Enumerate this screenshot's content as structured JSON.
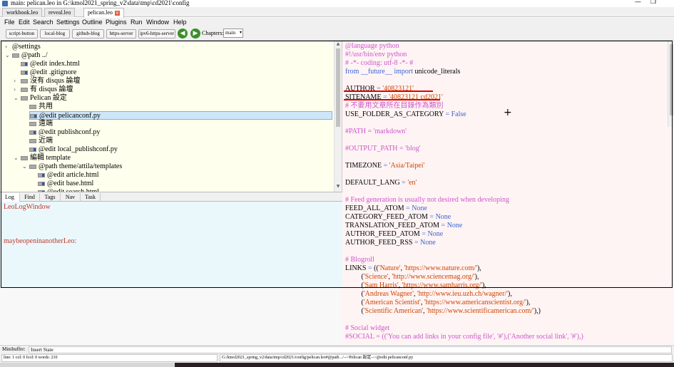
{
  "window": {
    "title": "main: pelican.leo in G:\\kmol2021_spring_v2\\data\\tmp\\cd2021\\config",
    "minimize": "—",
    "maximize": "❐"
  },
  "tabs": [
    {
      "label": "workbook.leo",
      "active": false
    },
    {
      "label": "reveal.leo",
      "active": false
    },
    {
      "label": "pelican.leo",
      "active": true
    }
  ],
  "tab_close": "×",
  "menu": [
    "File",
    "Edit",
    "Search",
    "Settings",
    "Outline",
    "Plugins",
    "Run",
    "Window",
    "Help"
  ],
  "toolbar": {
    "buttons": [
      "script-button",
      "local-blog",
      "github-blog",
      "https-server",
      "ipv6-https-server"
    ],
    "back": "◀",
    "forward": "▶",
    "chapters_label": "Chapters:",
    "chapters_value": "main",
    "chapters_arrow": "▾"
  },
  "outline": {
    "nodes": [
      {
        "text": "@settings",
        "expander": ">",
        "icon": false,
        "dirty": false,
        "selected": false
      },
      {
        "text": "@path ../",
        "expander": "v",
        "icon": true,
        "dirty": false,
        "selected": false
      },
      {
        "text": "@edit index.html",
        "expander": "",
        "icon": true,
        "dirty": true,
        "selected": false
      },
      {
        "text": "@edit .gitignore",
        "expander": "",
        "icon": true,
        "dirty": true,
        "selected": false
      },
      {
        "text": "沒有 disqus 論壇",
        "expander": ">",
        "icon": true,
        "dirty": false,
        "selected": false
      },
      {
        "text": "有 disqus 論壇",
        "expander": ">",
        "icon": true,
        "dirty": false,
        "selected": false
      },
      {
        "text": "Pelican 設定",
        "expander": "v",
        "icon": true,
        "dirty": false,
        "selected": false
      },
      {
        "text": "共用",
        "expander": "",
        "icon": true,
        "dirty": false,
        "selected": false
      },
      {
        "text": "@edit pelicanconf.py",
        "expander": "",
        "icon": true,
        "dirty": true,
        "selected": true
      },
      {
        "text": "遠端",
        "expander": "",
        "icon": true,
        "dirty": false,
        "selected": false
      },
      {
        "text": "@edit publishconf.py",
        "expander": "",
        "icon": true,
        "dirty": true,
        "selected": false
      },
      {
        "text": "近端",
        "expander": "",
        "icon": true,
        "dirty": false,
        "selected": false
      },
      {
        "text": "@edit local_publishconf.py",
        "expander": "",
        "icon": true,
        "dirty": true,
        "selected": false
      },
      {
        "text": "編輯 template",
        "expander": "v",
        "icon": true,
        "dirty": false,
        "selected": false
      },
      {
        "text": "@path theme/attila/templates",
        "expander": "v",
        "icon": true,
        "dirty": false,
        "selected": false
      },
      {
        "text": "@edit article.html",
        "expander": "",
        "icon": true,
        "dirty": true,
        "selected": false
      },
      {
        "text": "@edit base.html",
        "expander": "",
        "icon": true,
        "dirty": true,
        "selected": false
      },
      {
        "text": "@edit search.html",
        "expander": "",
        "icon": true,
        "dirty": true,
        "selected": false
      }
    ]
  },
  "scroll_arrows": {
    "up": "▲",
    "down": "▼"
  },
  "log_tabs": [
    "Log",
    "Find",
    "Tags",
    "Nav",
    "Task"
  ],
  "log_lines": [
    "LeoLogWindow",
    "maybeopeninanotherLeo:"
  ],
  "body_lines": [
    [
      {
        "t": "@language python",
        "c": "dir"
      }
    ],
    [
      {
        "t": "#!/usr/bin/env python",
        "c": "com"
      }
    ],
    [
      {
        "t": "# -*- coding: utf-8 -*- #",
        "c": "com"
      }
    ],
    [
      {
        "t": "from ",
        "c": "kw"
      },
      {
        "t": "__future__",
        "c": "kw"
      },
      {
        "t": " import ",
        "c": "kw"
      },
      {
        "t": "unicode_literals",
        "c": "id"
      }
    ],
    [],
    [
      {
        "t": "AUTHOR",
        "c": "id"
      },
      {
        "t": " = ",
        "c": "op"
      },
      {
        "t": "'40823121'",
        "c": "str"
      }
    ],
    [
      {
        "t": "SITENAME",
        "c": "id"
      },
      {
        "t": " = ",
        "c": "op"
      },
      {
        "t": "'40823121 cd2021'",
        "c": "str"
      }
    ],
    [
      {
        "t": "# 不要用文章所在目錄作為類別",
        "c": "com"
      }
    ],
    [
      {
        "t": "USE_FOLDER_AS_CATEGORY",
        "c": "id"
      },
      {
        "t": " = ",
        "c": "op"
      },
      {
        "t": "False",
        "c": "kw"
      }
    ],
    [],
    [
      {
        "t": "#PATH = 'markdown'",
        "c": "com"
      }
    ],
    [],
    [
      {
        "t": "#OUTPUT_PATH = 'blog'",
        "c": "com"
      }
    ],
    [],
    [
      {
        "t": "TIMEZONE",
        "c": "id"
      },
      {
        "t": " = ",
        "c": "op"
      },
      {
        "t": "'Asia/Taipei'",
        "c": "str"
      }
    ],
    [],
    [
      {
        "t": "DEFAULT_LANG",
        "c": "id"
      },
      {
        "t": " = ",
        "c": "op"
      },
      {
        "t": "'en'",
        "c": "str"
      }
    ],
    [],
    [
      {
        "t": "# Feed generation is usually not desired when developing",
        "c": "com"
      }
    ],
    [
      {
        "t": "FEED_ALL_ATOM",
        "c": "id"
      },
      {
        "t": " = ",
        "c": "op"
      },
      {
        "t": "None",
        "c": "kw"
      }
    ],
    [
      {
        "t": "CATEGORY_FEED_ATOM",
        "c": "id"
      },
      {
        "t": " = ",
        "c": "op"
      },
      {
        "t": "None",
        "c": "kw"
      }
    ],
    [
      {
        "t": "TRANSLATION_FEED_ATOM",
        "c": "id"
      },
      {
        "t": " = ",
        "c": "op"
      },
      {
        "t": "None",
        "c": "kw"
      }
    ],
    [
      {
        "t": "AUTHOR_FEED_ATOM",
        "c": "id"
      },
      {
        "t": " = ",
        "c": "op"
      },
      {
        "t": "None",
        "c": "kw"
      }
    ],
    [
      {
        "t": "AUTHOR_FEED_RSS",
        "c": "id"
      },
      {
        "t": " = ",
        "c": "op"
      },
      {
        "t": "None",
        "c": "kw"
      }
    ],
    [],
    [
      {
        "t": "# Blogroll",
        "c": "com"
      }
    ],
    [
      {
        "t": "LINKS",
        "c": "id"
      },
      {
        "t": " = ",
        "c": "op"
      },
      {
        "t": "((",
        "c": "id"
      },
      {
        "t": "'Nature'",
        "c": "str"
      },
      {
        "t": ", ",
        "c": "id"
      },
      {
        "t": "'https://www.nature.com/'",
        "c": "str"
      },
      {
        "t": "),",
        "c": "id"
      }
    ],
    [
      {
        "t": "         (",
        "c": "id"
      },
      {
        "t": "'Science'",
        "c": "str"
      },
      {
        "t": ", ",
        "c": "id"
      },
      {
        "t": "'http://www.sciencemag.org/'",
        "c": "str"
      },
      {
        "t": "),",
        "c": "id"
      }
    ],
    [
      {
        "t": "         (",
        "c": "id"
      },
      {
        "t": "'Sam Harris'",
        "c": "str"
      },
      {
        "t": ", ",
        "c": "id"
      },
      {
        "t": "'https://www.samharris.org/'",
        "c": "str"
      },
      {
        "t": "),",
        "c": "id"
      }
    ],
    [
      {
        "t": "         (",
        "c": "id"
      },
      {
        "t": "'Andreas Wagner'",
        "c": "str"
      },
      {
        "t": ", ",
        "c": "id"
      },
      {
        "t": "'http://www.ieu.uzh.ch/wagner/'",
        "c": "str"
      },
      {
        "t": "),",
        "c": "id"
      }
    ],
    [
      {
        "t": "         (",
        "c": "id"
      },
      {
        "t": "'American Scientist'",
        "c": "str"
      },
      {
        "t": ", ",
        "c": "id"
      },
      {
        "t": "'https://www.americanscientist.org/'",
        "c": "str"
      },
      {
        "t": "),",
        "c": "id"
      }
    ],
    [
      {
        "t": "         (",
        "c": "id"
      },
      {
        "t": "'Scientific American'",
        "c": "str"
      },
      {
        "t": ", ",
        "c": "id"
      },
      {
        "t": "'https://www.scientificamerican.com/'",
        "c": "str"
      },
      {
        "t": "),)",
        "c": "id"
      }
    ],
    [],
    [
      {
        "t": "# Social widget",
        "c": "com"
      }
    ],
    [
      {
        "t": "#SOCIAL = (('You can add links in your config file', '#'),('Another social link', '#'),)",
        "c": "com"
      }
    ]
  ],
  "crosshair": "+",
  "minibuffer": {
    "label": "Minibuffer:",
    "value": "Insert State"
  },
  "status": {
    "position": "line: 1 col: 0  fcol: 0 words: 210",
    "path": "G:/kmol2021_spring_v2/data/tmp/cd2021/config/pelican.leo#@path ../-->Pelican 設定-->@edit pelicanconf.py"
  },
  "colors": {
    "outline_bg": "#ffffee",
    "log_bg": "#eaf8fc",
    "body_bg": "#fff4f4",
    "selection": "#cfe6f8",
    "annotation_red": "#e00000",
    "nav_green": "#3c8f2c"
  }
}
